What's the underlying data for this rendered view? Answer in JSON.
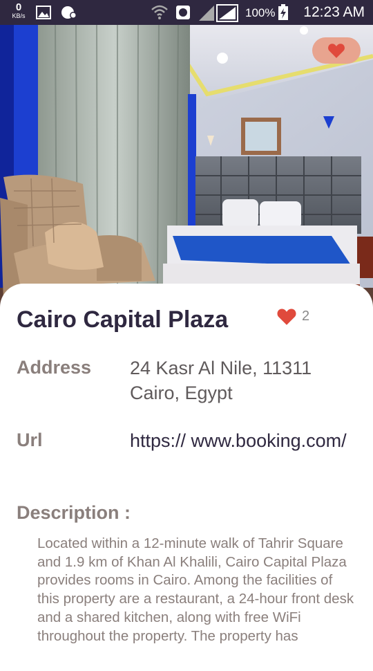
{
  "status_bar": {
    "speed_value": "0",
    "speed_unit": "KB/s",
    "battery": "100%",
    "time": "12:23 AM"
  },
  "hotel": {
    "name": "Cairo Capital Plaza",
    "likes": "2",
    "address_label": "Address",
    "address": "24 Kasr Al Nile, 11311 Cairo, Egypt",
    "url_label": "Url",
    "url": "https:// www.booking.com/",
    "description_label": "Description :",
    "description": "Located within a 12-minute walk of Tahrir Square and 1.9 km of Khan Al Khalili, Cairo Capital Plaza provides rooms in Cairo. Among the facilities of this property are a restaurant, a 24-hour front desk and a shared kitchen, along with free WiFi throughout the property. The property has"
  },
  "colors": {
    "status_bar": "#2f2840",
    "title": "#2f2840",
    "favorite_button_bg": "#e8a48f",
    "heart": "#e04a3c",
    "label": "#8a7f7c",
    "value": "#5f5a5b"
  },
  "icons": {
    "favorite": "heart-icon",
    "likes": "heart-icon"
  }
}
